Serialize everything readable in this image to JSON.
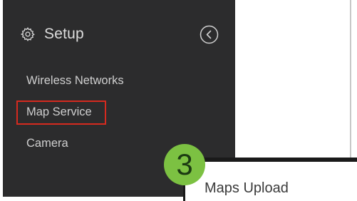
{
  "sidebar": {
    "title": "Setup",
    "icon": "gear-icon",
    "collapse_icon": "chevron-left-circle-icon",
    "items": [
      {
        "label": "Wireless Networks"
      },
      {
        "label": "Map Service",
        "highlighted": true
      },
      {
        "label": "Camera"
      }
    ]
  },
  "panel": {
    "label": "Maps Upload"
  },
  "annotation": {
    "step": "3"
  },
  "colors": {
    "sidebar_bg": "#2c2c2d",
    "highlight": "#d62a1f",
    "badge": "#7cc142"
  }
}
